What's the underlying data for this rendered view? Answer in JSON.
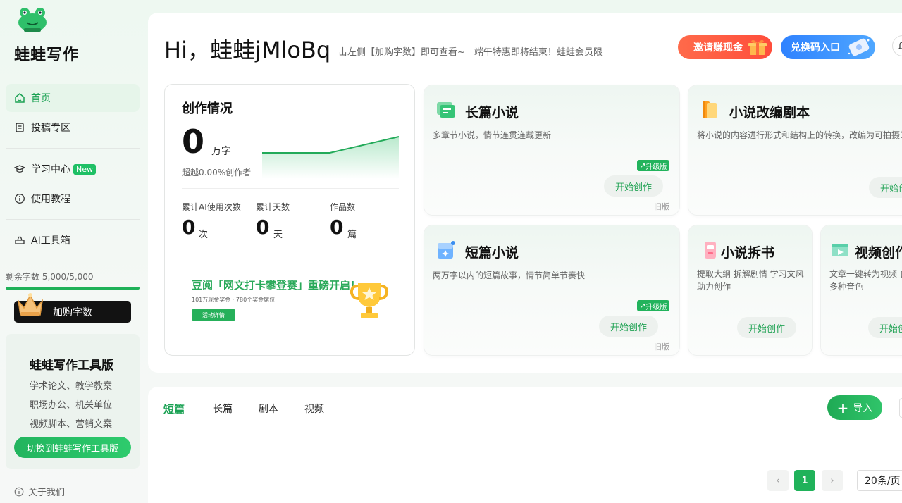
{
  "brand": {
    "name": "蛙蛙写作"
  },
  "nav": {
    "home": "首页",
    "submission": "投稿专区",
    "learning": "学习中心",
    "learning_badge": "New",
    "tutorial": "使用教程",
    "ai_tools": "AI工具箱"
  },
  "quota": {
    "text": "剩余字数 5,000/5,000",
    "fraction": 1.0,
    "buy_label": "加购字数"
  },
  "tool_edition": {
    "title": "蛙蛙写作工具版",
    "lines": [
      "学术论文、教学教案",
      "职场办公、机关单位",
      "视频脚本、营销文案"
    ],
    "switch_label": "切换到蛙蛙写作工具版"
  },
  "about": "关于我们",
  "header": {
    "greeting": "Hi，蛙蛙jMloBq",
    "marquee": "击左侧【加购字数】即可查看~　端午特惠即将结束！蛙蛙会员限",
    "invite_label": "邀请赚现金",
    "redeem_label": "兑换码入口"
  },
  "stats": {
    "title": "创作情况",
    "words_value": "0",
    "words_unit": "万字",
    "exceed_text": "超越0.00%创作者",
    "metrics": [
      {
        "label": "累计AI使用次数",
        "value": "0",
        "unit": "次"
      },
      {
        "label": "累计天数",
        "value": "0",
        "unit": "天"
      },
      {
        "label": "作品数",
        "value": "0",
        "unit": "篇"
      }
    ],
    "promo": {
      "title": "豆阅「网文打卡攀登赛」重磅开启!",
      "subtitle": "101万现金奖金 · 780个奖金席位",
      "button": "活动详情"
    }
  },
  "features": {
    "long_novel": {
      "title": "长篇小说",
      "desc": "多章节小说，情节连贯连载更新",
      "tag": "升级版",
      "start": "开始创作",
      "old": "旧版"
    },
    "script": {
      "title": "小说改编剧本",
      "desc": "将小说的内容进行形式和结构上的转换，改编为可拍摄的",
      "start": "开始创作"
    },
    "short_novel": {
      "title": "短篇小说",
      "desc": "两万字以内的短篇故事，情节简单节奏快",
      "tag": "升级版",
      "start": "开始创作",
      "old": "旧版"
    },
    "split_book": {
      "title": "小说拆书",
      "desc_lines": [
        "提取大纲 拆解剧情 学习文风",
        "助力创作"
      ],
      "start": "开始创作"
    },
    "video": {
      "title": "视频创作",
      "desc_lines": [
        "文章一键转为视频 自",
        "多种音色"
      ],
      "start": "开始创作"
    }
  },
  "tabs": [
    "短篇",
    "长篇",
    "剧本",
    "视频"
  ],
  "import_label": "导入",
  "pagination": {
    "prev": "‹",
    "current": "1",
    "next": "›",
    "page_size": "20条/页"
  },
  "colors": {
    "accent": "#1aa153",
    "red_button": "#ff5a40",
    "blue_button": "#3b8ef8"
  }
}
